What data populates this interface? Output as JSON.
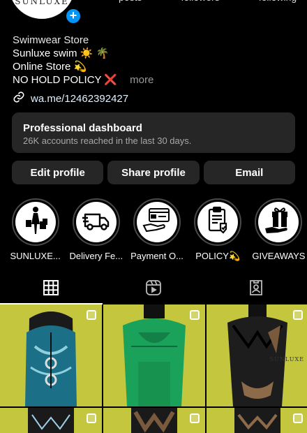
{
  "header": {
    "avatar_text": "SUNLUXE",
    "stats": [
      "posts",
      "followers",
      "following"
    ]
  },
  "bio": {
    "category": "Swimwear Store",
    "line1": "Sunluxe swim ☀️ 🌴",
    "line2": "Online Store 💫",
    "line3": "NO HOLD POLICY ❌",
    "more": "more",
    "link": "wa.me/12462392427"
  },
  "dashboard": {
    "title": "Professional dashboard",
    "subtitle": "26K accounts reached in the last 30 days."
  },
  "buttons": {
    "edit": "Edit profile",
    "share": "Share profile",
    "email": "Email"
  },
  "highlights": [
    {
      "label": "SUNLUXE...",
      "icon": "shopper-icon"
    },
    {
      "label": "Delivery Fe...",
      "icon": "delivery-truck-icon"
    },
    {
      "label": "Payment O...",
      "icon": "payment-card-icon"
    },
    {
      "label": "POLICY💫",
      "icon": "policy-clipboard-icon"
    },
    {
      "label": "GIVEAWAYS",
      "icon": "gift-icon"
    }
  ],
  "tabs": [
    "grid-icon",
    "reels-icon",
    "tagged-icon"
  ],
  "grid": {
    "watermark": "SUNLUXE",
    "colors": {
      "background": "#c4c63e",
      "suit1": "#1b6f86",
      "suit2": "#1aa15a",
      "suit3": "#1d1d1d"
    }
  }
}
